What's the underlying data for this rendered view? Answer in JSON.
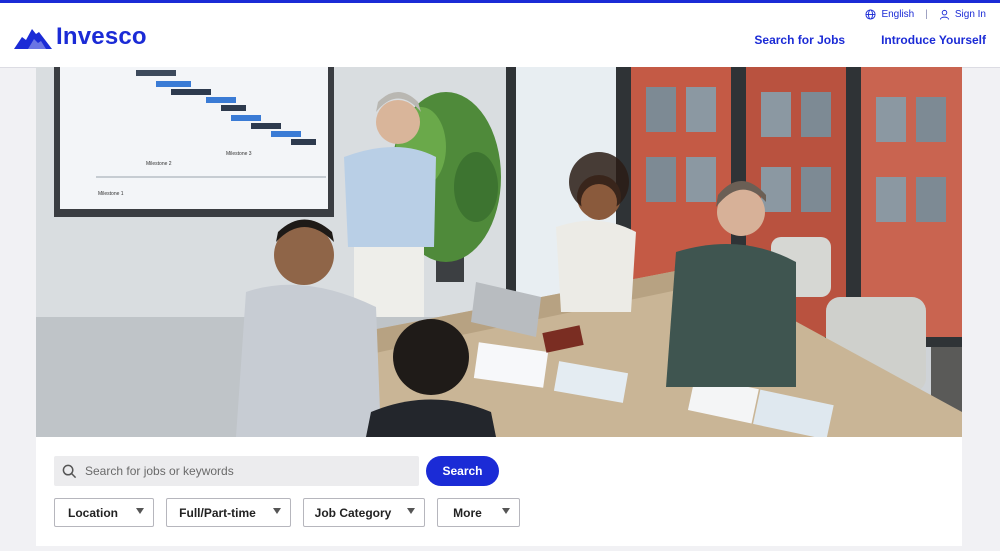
{
  "brand": {
    "name": "Invesco",
    "accent": "#1b2bd6"
  },
  "utility_nav": {
    "language": "English",
    "sign_in": "Sign In"
  },
  "main_nav": {
    "search_jobs": "Search for Jobs",
    "introduce": "Introduce Yourself"
  },
  "hero": {
    "image_label": "Team meeting in conference room",
    "screen_milestones": [
      "Milestone 1",
      "Milestone 2",
      "Milestone 3"
    ]
  },
  "search": {
    "placeholder": "Search for jobs or keywords",
    "button": "Search"
  },
  "filters": [
    {
      "label": "Location"
    },
    {
      "label": "Full/Part-time"
    },
    {
      "label": "Job Category"
    },
    {
      "label": "More"
    }
  ]
}
